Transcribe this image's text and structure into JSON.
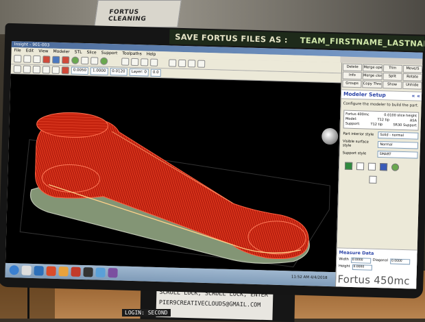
{
  "room": {
    "sign_text": "FORTUS CLEANING"
  },
  "banner": {
    "label": "SAVE FORTUS FILES AS :",
    "pattern": "TEAM_FIRSTNAME_LASTNAME_PROJEC"
  },
  "app": {
    "title": "Insight - 901-003",
    "menu": [
      "File",
      "Edit",
      "View",
      "Modeler",
      "STL",
      "Slice",
      "Support",
      "Toolpaths",
      "Help"
    ],
    "toolbar_fields": [
      "0.0050",
      "1.0000",
      "0.0120",
      "Layer: 0",
      "0.0"
    ]
  },
  "panel": {
    "buttons": [
      "Delete",
      "Merge open",
      "Trim",
      "Move/S",
      "Info",
      "Merge closed",
      "Split",
      "Rotate",
      "Groups",
      "Copy Through Z",
      "Show",
      "Unhide"
    ],
    "modeler_setup_title": "Modeler Setup",
    "nav_back": "«",
    "nav_forward": "«",
    "description": "Configure the modeler to build the part.",
    "info": {
      "rows": [
        {
          "label": "Fortus 400mc",
          "value": "0.0100 slice height"
        },
        {
          "label": "Model:",
          "value": "ASA"
        },
        {
          "label": "Support:",
          "value": "SR30 Support"
        }
      ],
      "tip_label": "T12 tip",
      "tip_label2": "T12 tip"
    },
    "settings": [
      {
        "label": "Part interior style",
        "value": "Solid - normal"
      },
      {
        "label": "Visible surface style",
        "value": "Normal"
      },
      {
        "label": "Support style",
        "value": "SMART"
      }
    ],
    "measure": {
      "title": "Measure Data",
      "rows": [
        {
          "label": "Width",
          "value": "0.0000",
          "label2": "Diagonal",
          "value2": "0.0000"
        },
        {
          "label": "Height",
          "value": "0.0000"
        }
      ]
    },
    "brand": "Fortus 450mc"
  },
  "taskbar": {
    "clock": "11:52 AM",
    "date": "4/4/2018"
  },
  "desk_sticker": {
    "lines": [
      "SCROLL LOCK, SCROLL LOCK, ENTER",
      "PIER9CREATIVECLOUDS@GMAIL.COM",
      "LOGIN: SECOND"
    ]
  },
  "colors": {
    "part": "#e0321f",
    "viewport": "#000000",
    "panel_title": "#2e46a8",
    "banner_bg": "#1e2a1a"
  }
}
